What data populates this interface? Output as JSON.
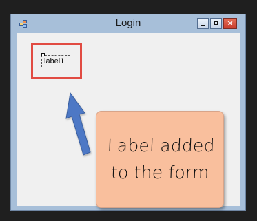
{
  "window": {
    "title": "Login",
    "title_icon": "application-form-icon",
    "buttons": {
      "minimize_icon": "minimize-icon",
      "maximize_icon": "maximize-icon",
      "close_icon": "close-icon",
      "close_label": "✕"
    }
  },
  "client": {
    "control_label": "label1"
  },
  "annotation": {
    "arrow_icon": "arrow-up-left-icon",
    "text": "Label added to the form"
  },
  "colors": {
    "highlight": "#e14b42",
    "callout": "#f9bf9d",
    "arrow": "#4d78c5"
  }
}
